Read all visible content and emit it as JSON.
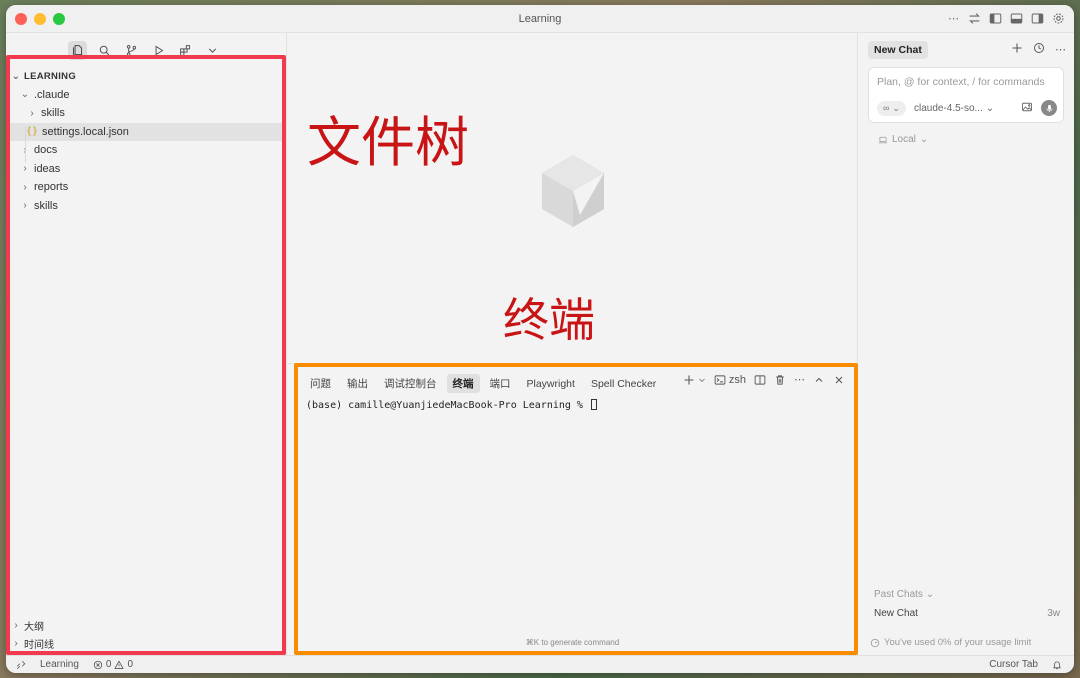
{
  "window": {
    "title": "Learning"
  },
  "explorer": {
    "root_label": "LEARNING",
    "items": [
      {
        "label": ".claude",
        "expanded": true,
        "depth": 0
      },
      {
        "label": "skills",
        "expanded": false,
        "depth": 1
      },
      {
        "label": "settings.local.json",
        "file": true,
        "depth": 1,
        "selected": true
      },
      {
        "label": "docs",
        "expanded": false,
        "depth": 0
      },
      {
        "label": "ideas",
        "expanded": false,
        "depth": 0
      },
      {
        "label": "reports",
        "expanded": false,
        "depth": 0
      },
      {
        "label": "skills",
        "expanded": false,
        "depth": 0
      }
    ],
    "bottom_sections": [
      "大纲",
      "时间线"
    ]
  },
  "annotations": {
    "file_tree": "文件树",
    "terminal": "终端"
  },
  "panel": {
    "tabs": [
      "问题",
      "输出",
      "调试控制台",
      "终端",
      "端口",
      "Playwright",
      "Spell Checker"
    ],
    "active_tab": "终端",
    "shell": "zsh",
    "prompt": "(base) camille@YuanjiedeMacBook-Pro Learning % ",
    "hint": "⌘K to generate command"
  },
  "chat": {
    "tab_label": "New Chat",
    "placeholder": "Plan, @ for context, / for commands",
    "mode_glyph": "∞",
    "model": "claude-4.5-so...",
    "location": "Local",
    "past_chats_label": "Past Chats",
    "past_chats": [
      {
        "title": "New Chat",
        "age": "3w"
      }
    ],
    "usage_text": "You've used 0% of your usage limit"
  },
  "status": {
    "workspace": "Learning",
    "errors": "0",
    "warnings": "0",
    "cursor_tab": "Cursor Tab"
  }
}
